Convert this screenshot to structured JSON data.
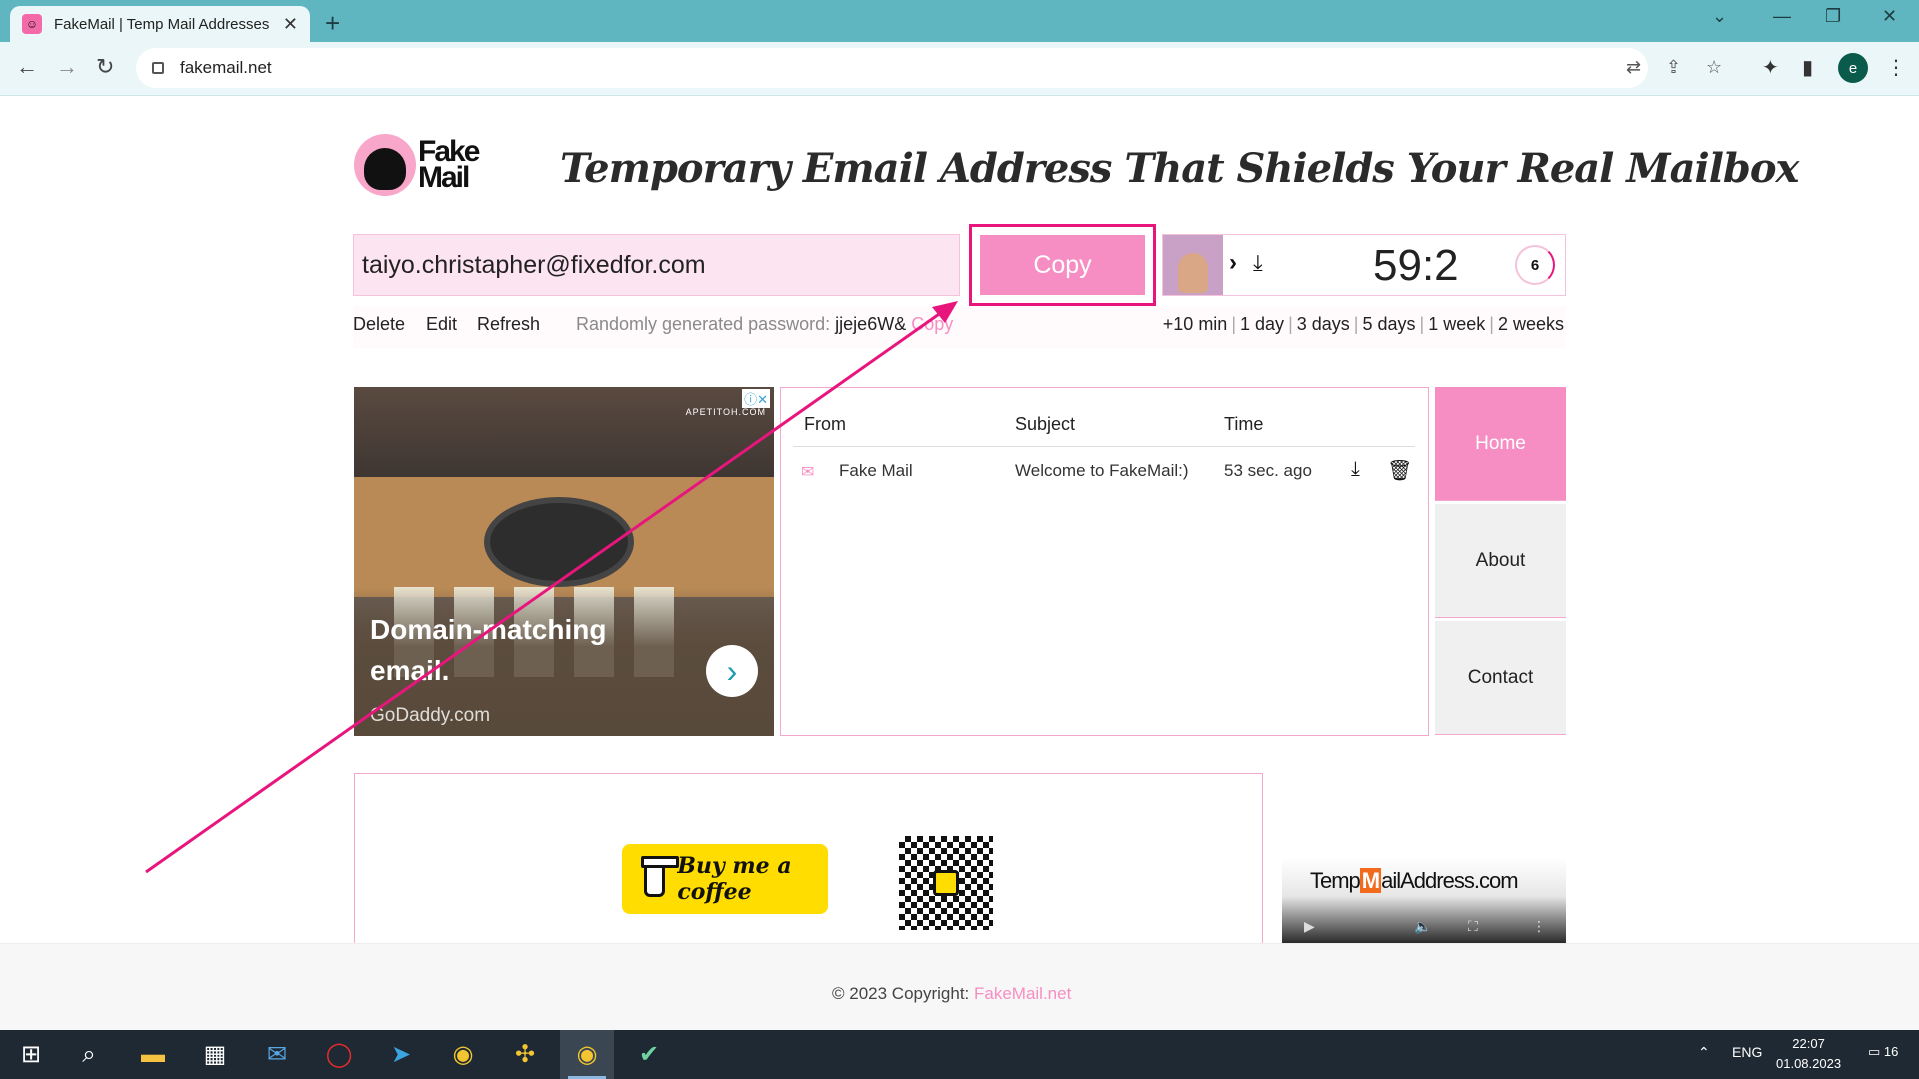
{
  "browser": {
    "tab_title": "FakeMail | Temp Mail Addresses",
    "tab_close": "✕",
    "new_tab": "+",
    "url": "fakemail.net",
    "profile_initial": "e"
  },
  "header": {
    "logo_text_line1": "Fake",
    "logo_text_line2": "Mail",
    "headline": "Temporary Email Address That Shields Your Real Mailbox"
  },
  "mailbox": {
    "email": "taiyo.christapher@fixedfor.com",
    "copy_label": "Copy",
    "timer": "59:2",
    "counter": "6",
    "actions": [
      "Delete",
      "Edit",
      "Refresh"
    ],
    "password_label": "Randomly generated password:",
    "password_value": "jjeje6W&",
    "password_copy": "Copy",
    "durations": [
      "+10 min",
      "1 day",
      "3 days",
      "5 days",
      "1 week",
      "2 weeks"
    ]
  },
  "ad": {
    "source": "APETITOH.COM",
    "headline": "Domain-matching email.",
    "domain": "GoDaddy.com",
    "arrow": "›"
  },
  "inbox": {
    "columns": [
      "From",
      "Subject",
      "Time"
    ],
    "rows": [
      {
        "from": "Fake Mail",
        "subject": "Welcome to FakeMail:)",
        "time": "53 sec. ago"
      }
    ]
  },
  "nav": {
    "items": [
      "Home",
      "About",
      "Contact"
    ],
    "active": "Home"
  },
  "donate": {
    "button_text": "Buy me a coffee"
  },
  "video": {
    "logo_pre": "Temp",
    "logo_m": "M",
    "logo_post": "ailAddress.com"
  },
  "footer": {
    "text": "© 2023 Copyright: ",
    "link": "FakeMail.net"
  },
  "taskbar": {
    "lang": "ENG",
    "time": "22:07",
    "date": "01.08.2023",
    "notifications": "16"
  },
  "colors": {
    "accent_pink": "#f78ec3",
    "annotation": "#e8157d",
    "tab_strip": "#5fb6c0"
  }
}
